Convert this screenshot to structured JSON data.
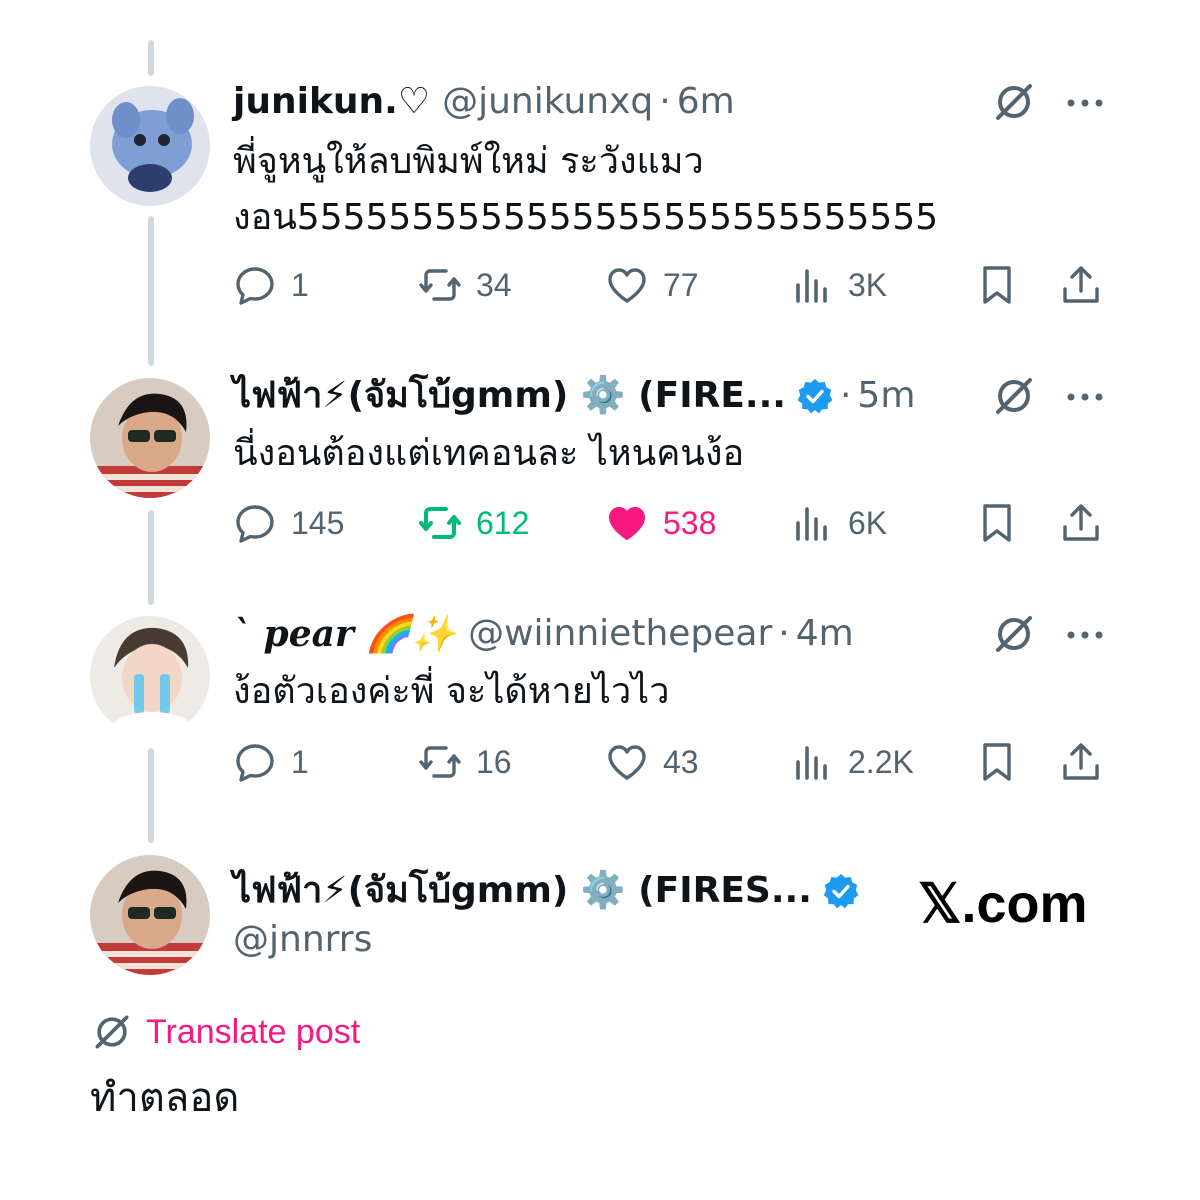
{
  "colors": {
    "accent": "#1d9bf0",
    "retweet_active": "#00ba7c",
    "like_active": "#f91880",
    "muted": "#536471"
  },
  "replies": [
    {
      "name": "junikun.♡",
      "handle": "@junikunxq",
      "time": "6m",
      "verified": false,
      "text_lines": [
        "พี่จูหนูให้ลบพิมพ์ใหม่ ระวังแมว",
        "งอน5555555555555555555555555555"
      ],
      "stats": {
        "replies": "1",
        "reposts": "34",
        "likes": "77",
        "views": "3K"
      },
      "reposted": false,
      "liked": false
    },
    {
      "name": "ไฟฟ้า⚡(จัมโบ้gmm) ⚙️ (FIRE...",
      "handle": "",
      "time": "5m",
      "verified": true,
      "text_lines": [
        "นี่งอนต้องแต่เทคอนละ ไหนคนง้อ"
      ],
      "stats": {
        "replies": "145",
        "reposts": "612",
        "likes": "538",
        "views": "6K"
      },
      "reposted": true,
      "liked": true
    },
    {
      "name": "` pear 🌈✨",
      "handle": "@wiinniethepear",
      "time": "4m",
      "verified": false,
      "text_lines": [
        "ง้อตัวเองค่ะพี่ จะได้หายไวไว"
      ],
      "stats": {
        "replies": "1",
        "reposts": "16",
        "likes": "43",
        "views": "2.2K"
      },
      "reposted": false,
      "liked": false
    }
  ],
  "main_post": {
    "name": "ไฟฟ้า⚡(จัมโบ้gmm) ⚙️ (FIRES...",
    "handle": "@jnnrrs",
    "verified": true,
    "translate_label": "Translate post",
    "text": "ทำตลอด"
  },
  "watermark": "𝕏.com",
  "icons": [
    "reply-icon",
    "repost-icon",
    "like-icon",
    "views-icon",
    "bookmark-icon",
    "share-icon",
    "grok-icon",
    "more-icon",
    "verified-badge-icon"
  ]
}
